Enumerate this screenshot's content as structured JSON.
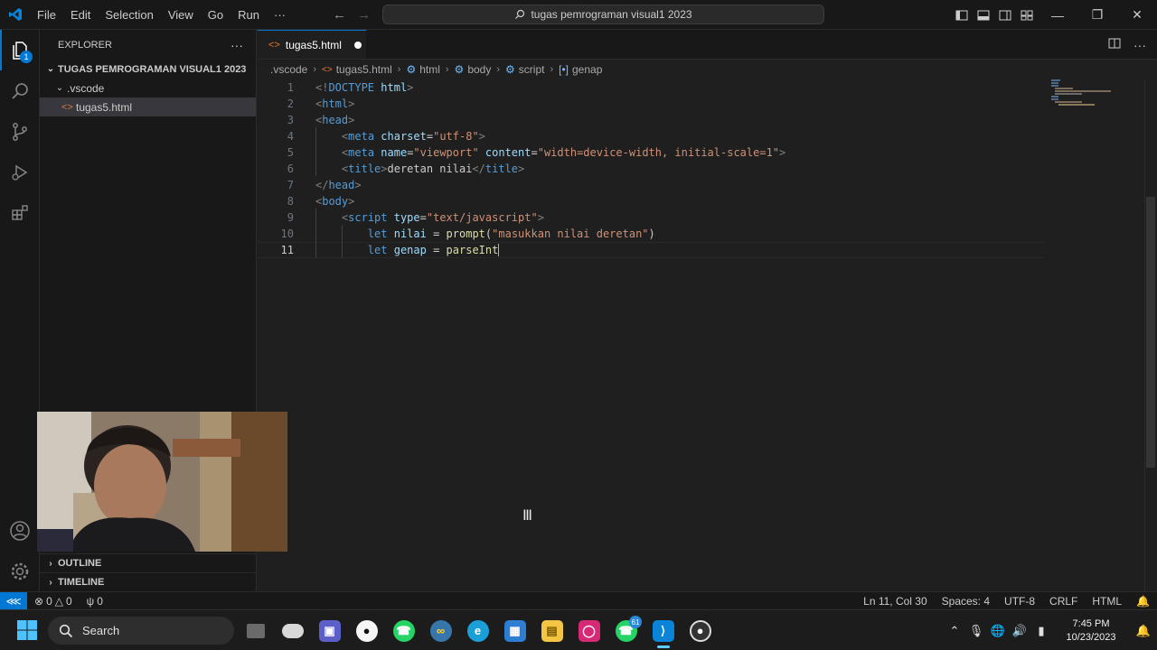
{
  "menu": [
    "File",
    "Edit",
    "Selection",
    "View",
    "Go",
    "Run",
    "···"
  ],
  "search": {
    "text": "tugas pemrograman visual1 2023"
  },
  "activity": {
    "explorer_badge": "1"
  },
  "sidebar": {
    "title": "EXPLORER",
    "more": "···",
    "workspace": "TUGAS PEMROGRAMAN VISUAL1 2023",
    "folder": ".vscode",
    "file": "tugas5.html",
    "outline": "OUTLINE",
    "timeline": "TIMELINE"
  },
  "tab": {
    "label": "tugas5.html"
  },
  "breadcrumb": [
    ".vscode",
    "tugas5.html",
    "html",
    "body",
    "script",
    "genap"
  ],
  "code": {
    "line_numbers": [
      "1",
      "2",
      "3",
      "4",
      "5",
      "6",
      "7",
      "8",
      "9",
      "10",
      "11"
    ],
    "current_line": 11
  },
  "status": {
    "errors": "0",
    "warnings": "0",
    "ports": "0",
    "position": "Ln 11, Col 30",
    "spaces": "Spaces: 4",
    "encoding": "UTF-8",
    "eol": "CRLF",
    "language": "HTML"
  },
  "taskbar": {
    "search_label": "Search",
    "whatsapp_badge": "61",
    "time": "7:45 PM",
    "date": "10/23/2023"
  },
  "colors": {
    "accent": "#0078d4",
    "tag": "#569cd6",
    "string": "#ce9178",
    "attribute": "#9cdcfe",
    "function": "#dcdcaa"
  }
}
